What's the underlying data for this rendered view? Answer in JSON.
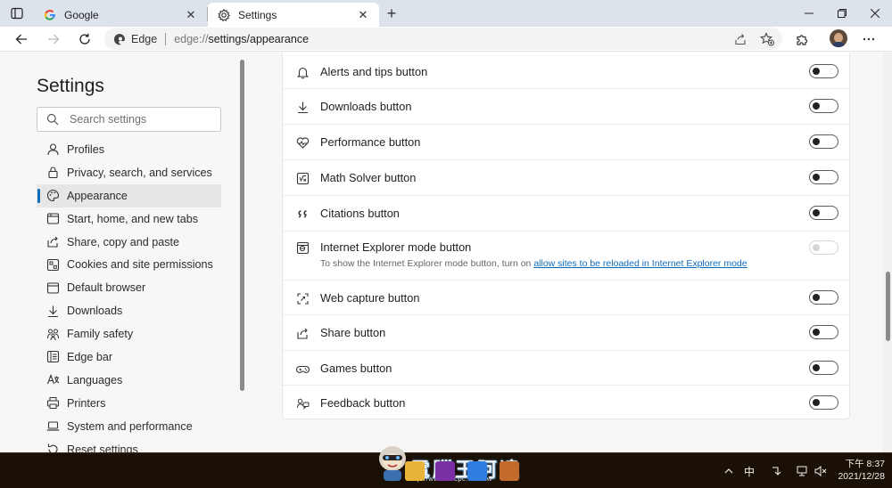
{
  "tabs": [
    {
      "label": "Google",
      "favicon": "google-icon"
    },
    {
      "label": "Settings",
      "favicon": "gear-icon",
      "active": true
    }
  ],
  "address": {
    "brand": "Edge",
    "scheme": "edge://",
    "path": "settings/appearance"
  },
  "sidebar": {
    "title": "Settings",
    "search_placeholder": "Search settings",
    "items": [
      {
        "label": "Profiles",
        "icon": "profile-icon"
      },
      {
        "label": "Privacy, search, and services",
        "icon": "lock-icon"
      },
      {
        "label": "Appearance",
        "icon": "palette-icon",
        "active": true
      },
      {
        "label": "Start, home, and new tabs",
        "icon": "home-tabs-icon"
      },
      {
        "label": "Share, copy and paste",
        "icon": "share-icon"
      },
      {
        "label": "Cookies and site permissions",
        "icon": "cookie-icon"
      },
      {
        "label": "Default browser",
        "icon": "browser-icon"
      },
      {
        "label": "Downloads",
        "icon": "download-icon"
      },
      {
        "label": "Family safety",
        "icon": "family-icon"
      },
      {
        "label": "Edge bar",
        "icon": "edge-bar-icon"
      },
      {
        "label": "Languages",
        "icon": "languages-icon"
      },
      {
        "label": "Printers",
        "icon": "printer-icon"
      },
      {
        "label": "System and performance",
        "icon": "laptop-icon"
      },
      {
        "label": "Reset settings",
        "icon": "reset-icon"
      }
    ]
  },
  "settings_rows": [
    {
      "label": "Alerts and tips button",
      "icon": "bell-icon",
      "on": false
    },
    {
      "label": "Downloads button",
      "icon": "download-icon",
      "on": false
    },
    {
      "label": "Performance button",
      "icon": "heartbeat-icon",
      "on": false
    },
    {
      "label": "Math Solver button",
      "icon": "math-solver-icon",
      "on": false
    },
    {
      "label": "Citations button",
      "icon": "quote-icon",
      "on": false
    },
    {
      "label": "Internet Explorer mode button",
      "icon": "ie-mode-icon",
      "on": false,
      "disabled": true,
      "description_prefix": "To show the Internet Explorer mode button, turn on ",
      "description_link": "allow sites to be reloaded in Internet Explorer mode"
    },
    {
      "label": "Web capture button",
      "icon": "web-capture-icon",
      "on": false
    },
    {
      "label": "Share button",
      "icon": "share-icon",
      "on": false
    },
    {
      "label": "Games button",
      "icon": "gamepad-icon",
      "on": false
    },
    {
      "label": "Feedback button",
      "icon": "feedback-icon",
      "on": false
    }
  ],
  "taskbar": {
    "ime": "中",
    "clock_line1": "下午 8:37",
    "clock_line2": "2021/12/28"
  },
  "watermark": {
    "text": "電腦王阿達",
    "url": "http://www.kocpc.com.tw"
  },
  "colors": {
    "accent": "#0f6cbd",
    "tabbar": "#dde3ea",
    "taskbar": "#1a1006"
  }
}
